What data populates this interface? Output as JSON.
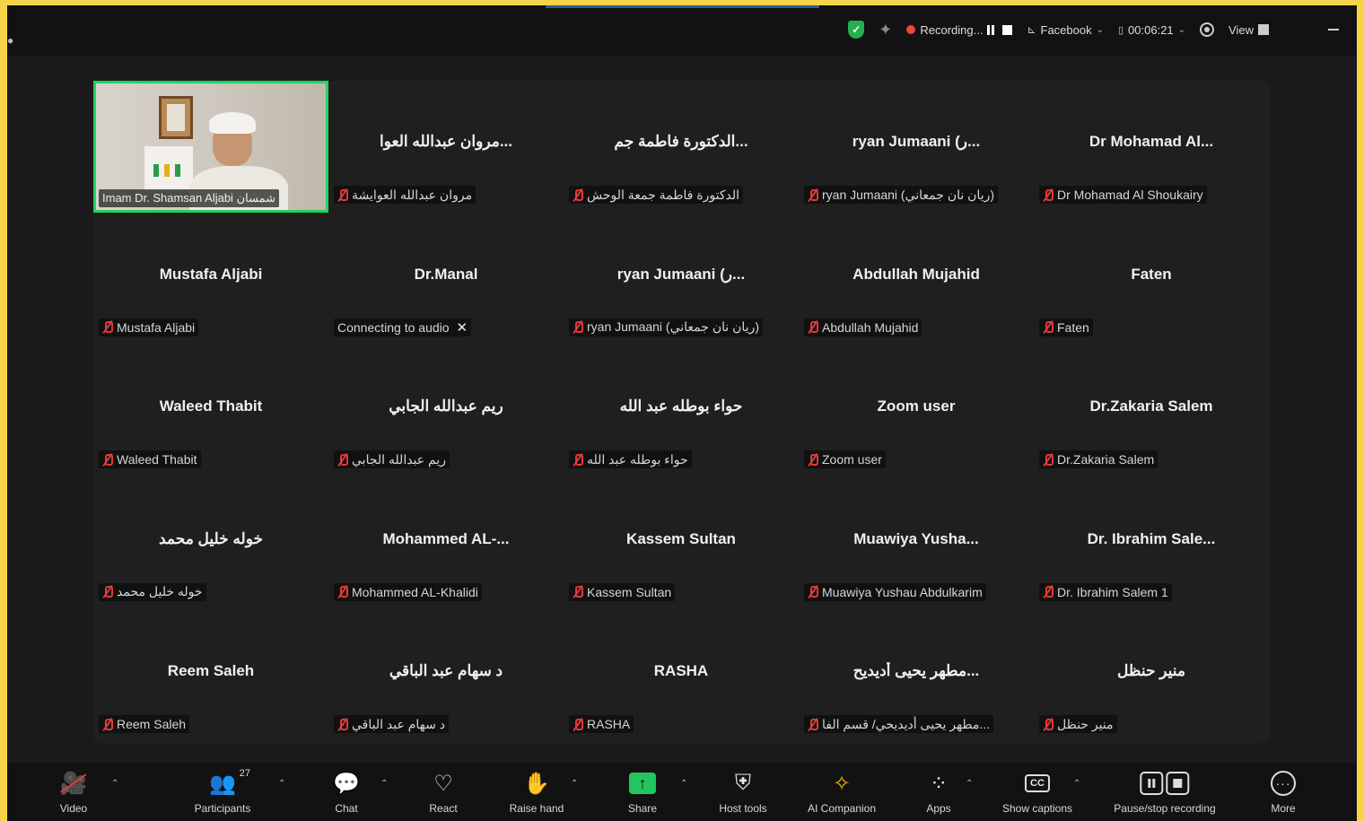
{
  "topbar": {
    "recording_label": "Recording...",
    "stream_label": "Facebook",
    "timer": "00:06:21",
    "view_label": "View"
  },
  "tiles": [
    {
      "name": "",
      "label": "Imam Dr. Shamsan Aljabi شمسان",
      "type": "video"
    },
    {
      "name": "مروان عبدالله العوا...",
      "label": "مروان عبدالله العوايشة",
      "type": "muted"
    },
    {
      "name": "الدكتورة فاطمة جم...",
      "label": "الدكتورة فاطمة جمعة الوحش",
      "type": "muted"
    },
    {
      "name": "ryan Jumaani (ر...",
      "label": "ryan Jumaani (ريان نان جمعاني)",
      "type": "muted"
    },
    {
      "name": "Dr Mohamad Al...",
      "label": "Dr Mohamad Al Shoukairy",
      "type": "muted"
    },
    {
      "name": "Mustafa Aljabi",
      "label": "Mustafa Aljabi",
      "type": "muted"
    },
    {
      "name": "Dr.Manal",
      "label": "Connecting to audio",
      "type": "connecting"
    },
    {
      "name": "ryan Jumaani (ر...",
      "label": "ryan Jumaani (ريان نان جمعاني)",
      "type": "muted"
    },
    {
      "name": "Abdullah Mujahid",
      "label": "Abdullah Mujahid",
      "type": "muted"
    },
    {
      "name": "Faten",
      "label": "Faten",
      "type": "muted"
    },
    {
      "name": "Waleed Thabit",
      "label": "Waleed Thabit",
      "type": "muted"
    },
    {
      "name": "ريم عبدالله الجابي",
      "label": "ريم عبدالله الجابي",
      "type": "muted"
    },
    {
      "name": "حواء بوطله عبد الله",
      "label": "حواء بوطله عبد الله",
      "type": "muted"
    },
    {
      "name": "Zoom user",
      "label": "Zoom user",
      "type": "muted"
    },
    {
      "name": "Dr.Zakaria Salem",
      "label": "Dr.Zakaria Salem",
      "type": "muted"
    },
    {
      "name": "خوله خليل محمد",
      "label": "خوله خليل محمد",
      "type": "muted"
    },
    {
      "name": "Mohammed AL-...",
      "label": "Mohammed AL-Khalidi",
      "type": "muted"
    },
    {
      "name": "Kassem Sultan",
      "label": "Kassem Sultan",
      "type": "muted"
    },
    {
      "name": "Muawiya Yusha...",
      "label": "Muawiya Yushau Abdulkarim",
      "type": "muted"
    },
    {
      "name": "Dr. Ibrahim Sale...",
      "label": "Dr. Ibrahim Salem 1",
      "type": "muted"
    },
    {
      "name": "Reem Saleh",
      "label": "Reem Saleh",
      "type": "muted"
    },
    {
      "name": "د سهام عبد الباقي",
      "label": "د سهام عبد الباقي",
      "type": "muted"
    },
    {
      "name": "RASHA",
      "label": "RASHA",
      "type": "muted"
    },
    {
      "name": "مطهر يحيى أديديح...",
      "label": "مطهر يحيى أديديحي/ قسم الفا...",
      "type": "muted"
    },
    {
      "name": "منير حنظل",
      "label": "منير حنظل",
      "type": "muted"
    }
  ],
  "toolbar": {
    "video": "Video",
    "participants": "Participants",
    "participants_count": "27",
    "chat": "Chat",
    "react": "React",
    "raise_hand": "Raise hand",
    "share": "Share",
    "host_tools": "Host tools",
    "ai_companion": "AI Companion",
    "apps": "Apps",
    "captions": "Show captions",
    "pause_recording": "Pause/stop recording",
    "more": "More"
  }
}
